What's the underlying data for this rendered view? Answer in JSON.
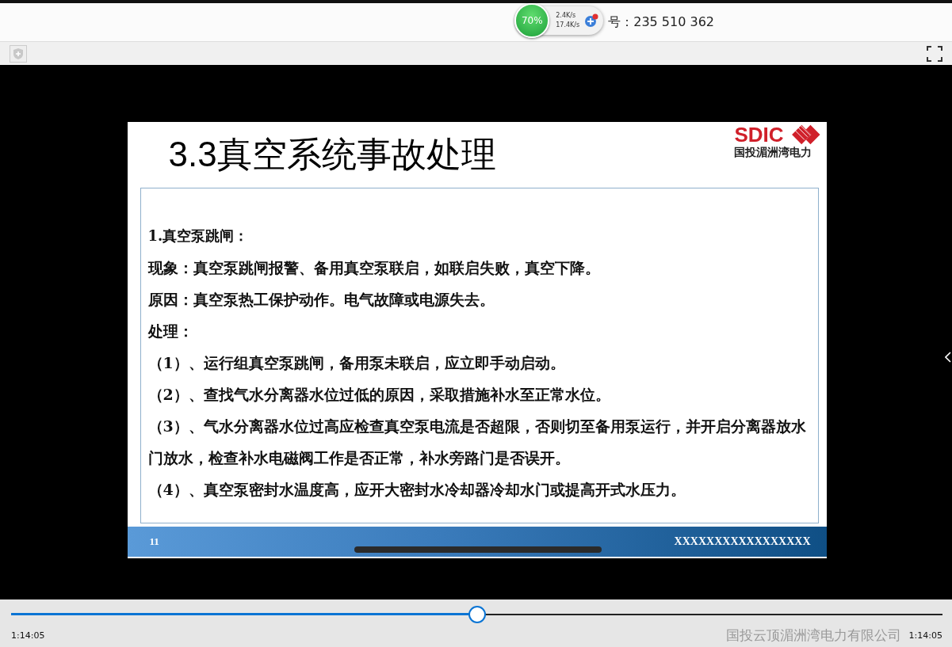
{
  "header": {
    "meeting_id": "号：235 510 362"
  },
  "net_widget": {
    "percent": "70%",
    "upload": "2.4K/s",
    "download": "17.4K/s"
  },
  "slide": {
    "title": "3.3真空系统事故处理",
    "logo_text": "SDIC",
    "logo_subtitle": "国投湄洲湾电力",
    "paragraphs": [
      {
        "kind": "heading",
        "text": "1.真空泵跳闸："
      },
      {
        "kind": "line",
        "text": "现象：真空泵跳闸报警、备用真空泵联启，如联启失败，真空下降。"
      },
      {
        "kind": "line",
        "text": "原因：真空泵热工保护动作。电气故障或电源失去。"
      },
      {
        "kind": "line",
        "text": "处理："
      },
      {
        "kind": "item",
        "text": "（1）、运行组真空泵跳闸，备用泵未联启，应立即手动启动。"
      },
      {
        "kind": "item",
        "text": "（2）、查找气水分离器水位过低的原因，采取措施补水至正常水位。"
      },
      {
        "kind": "item",
        "text": "（3）、气水分离器水位过高应检查真空泵电流是否超限，否则切至备用泵运行，并开启分离器放水门放水，检查补水电磁阀工作是否正常，补水旁路门是否误开。"
      },
      {
        "kind": "item",
        "text": "（4）、真空泵密封水温度高，应开大密封水冷却器冷却水门或提高开式水压力。"
      }
    ],
    "page_number": "11",
    "footer_text": "XXXXXXXXXXXXXXXXX"
  },
  "player": {
    "level": 0.5,
    "current_time": "1:14:05",
    "total_time": "1:14:05",
    "company": "国投云顶湄洲湾电力有限公司"
  }
}
